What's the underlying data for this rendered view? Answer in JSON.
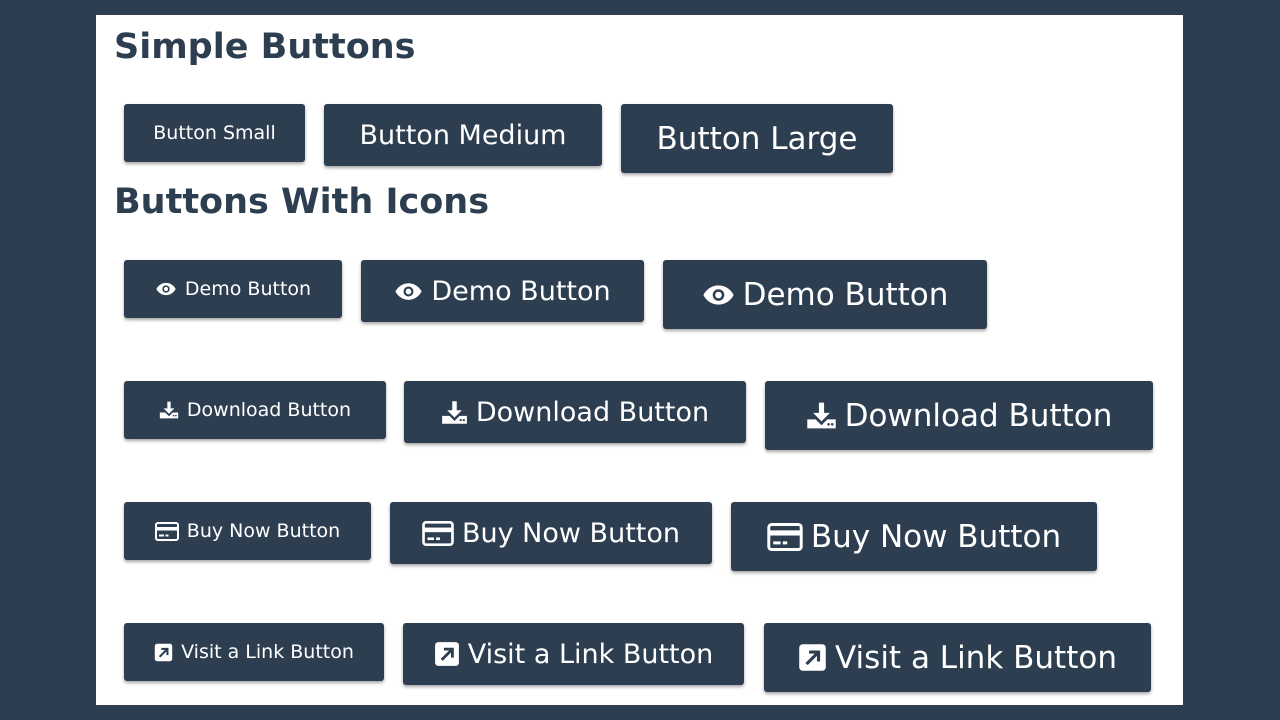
{
  "simple_section": {
    "heading": "Simple Buttons",
    "small_label": "Button Small",
    "medium_label": "Button Medium",
    "large_label": "Button Large"
  },
  "icons_section": {
    "heading": "Buttons With Icons",
    "demo_label": "Demo Button",
    "download_label": "Download Button",
    "buynow_label": "Buy Now Button",
    "visitlink_label": "Visit a Link Button"
  },
  "icons": {
    "demo": "eye-icon",
    "download": "download-icon",
    "buynow": "credit-card-icon",
    "visitlink": "external-link-icon"
  },
  "colors": {
    "background": "#2c3e50",
    "panel": "#ffffff",
    "button": "#2c3e50",
    "button_text": "#ffffff"
  }
}
